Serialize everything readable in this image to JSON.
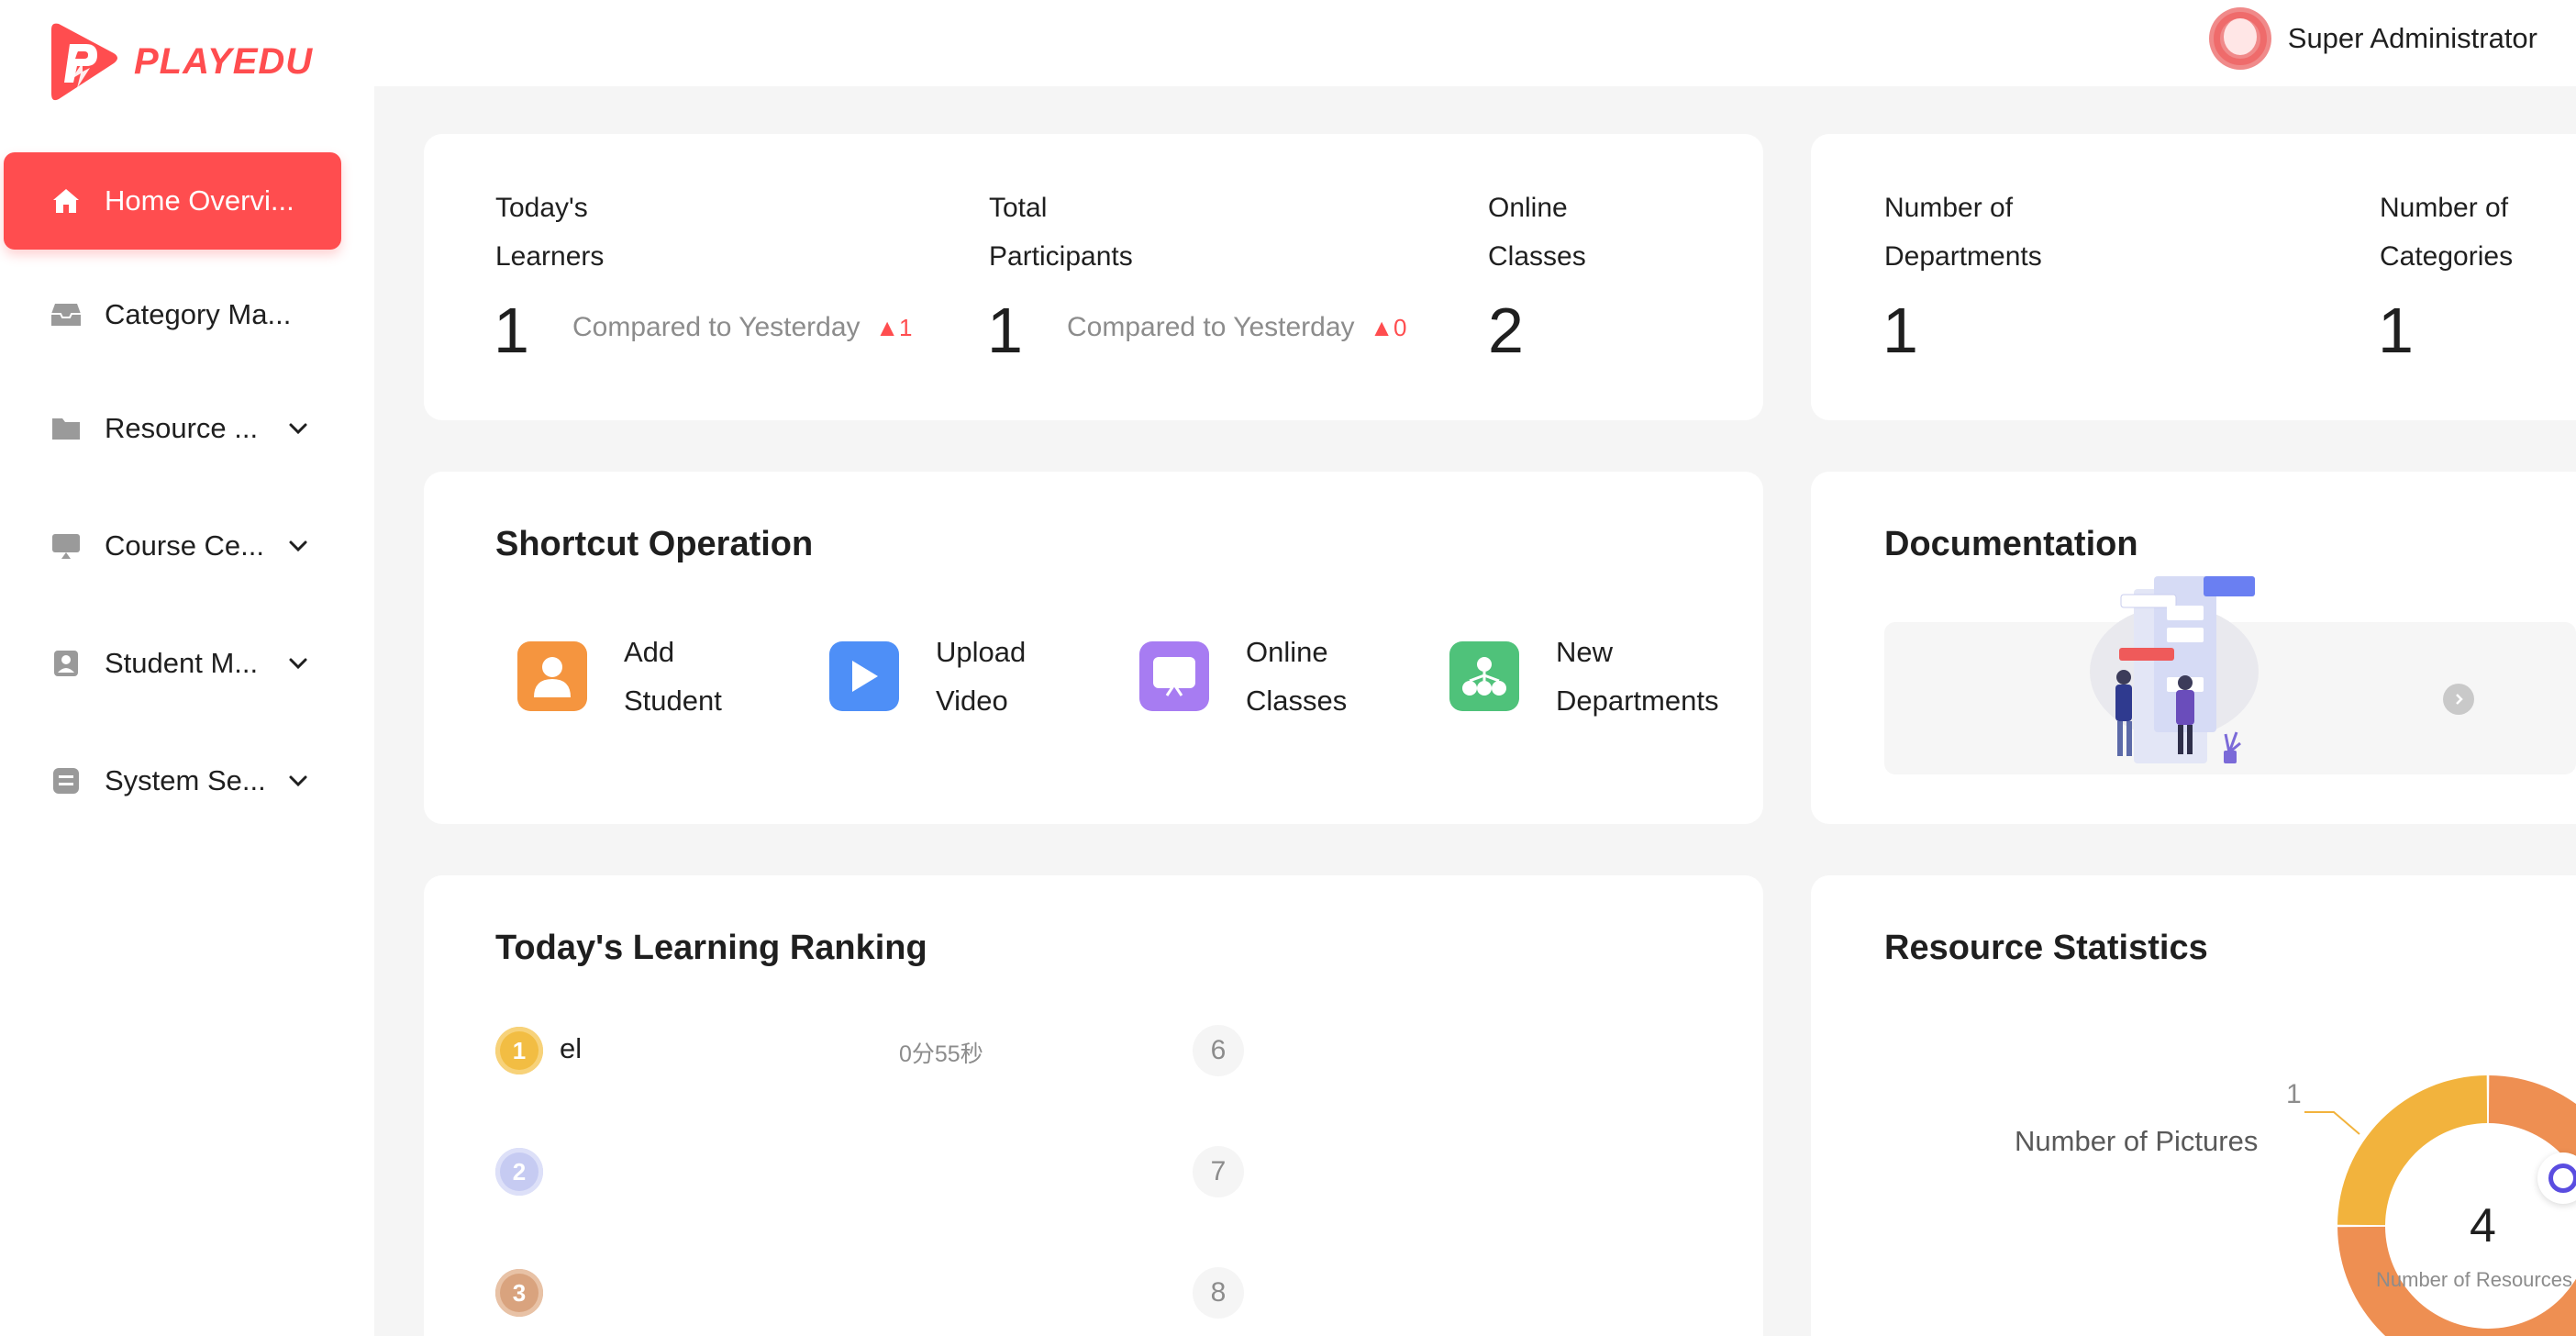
{
  "brand": {
    "name": "PLAYEDU",
    "color": "#ff4d4f"
  },
  "sidebar": {
    "items": [
      {
        "label": "Home Overvi...",
        "icon": "home-icon",
        "active": true
      },
      {
        "label": "Category Ma...",
        "icon": "inbox-icon"
      },
      {
        "label": "Resource ...",
        "icon": "folder-icon",
        "expandable": true
      },
      {
        "label": "Course Ce...",
        "icon": "screen-icon",
        "expandable": true
      },
      {
        "label": "Student M...",
        "icon": "student-icon",
        "expandable": true
      },
      {
        "label": "System Se...",
        "icon": "settings-icon",
        "expandable": true
      }
    ]
  },
  "header": {
    "user_name": "Super Administrator"
  },
  "stats": {
    "todays_learners": {
      "label_line1": "Today's",
      "label_line2": "Learners",
      "value": "1",
      "compare_text": "Compared to Yesterday",
      "delta": "1"
    },
    "total_participants": {
      "label_line1": "Total",
      "label_line2": "Participants",
      "value": "1",
      "compare_text": "Compared to Yesterday",
      "delta": "0"
    },
    "online_classes": {
      "label_line1": "Online",
      "label_line2": "Classes",
      "value": "2"
    },
    "departments": {
      "label_line1": "Number of",
      "label_line2": "Departments",
      "value": "1"
    },
    "categories": {
      "label_line1": "Number of",
      "label_line2": "Categories",
      "value": "1"
    }
  },
  "shortcuts": {
    "title": "Shortcut Operation",
    "items": [
      {
        "line1": "Add",
        "line2": "Student",
        "icon": "user-icon",
        "color": "#f5953f"
      },
      {
        "line1": "Upload",
        "line2": "Video",
        "icon": "play-icon",
        "color": "#4e8ff7"
      },
      {
        "line1": "Online",
        "line2": "Classes",
        "icon": "live-icon",
        "color": "#a77cf2"
      },
      {
        "line1": "New",
        "line2": "Departments",
        "icon": "department-icon",
        "color": "#4fc27a"
      }
    ]
  },
  "documentation": {
    "title": "Documentation"
  },
  "ranking": {
    "title": "Today's Learning Ranking",
    "rows": [
      {
        "rank": "1",
        "name": "el",
        "time": "0分55秒"
      },
      {
        "rank": "2",
        "name": "",
        "time": "",
        "num": "7"
      },
      {
        "rank": "3",
        "name": "",
        "time": "",
        "num": "8"
      }
    ],
    "first_num": "6"
  },
  "resources": {
    "title": "Resource Statistics",
    "center_value": "4",
    "center_label": "Number of Resources",
    "pictures_label": "Number of Pictures",
    "pictures_count": "1"
  },
  "chart_data": {
    "type": "pie",
    "title": "Resource Statistics",
    "total": 4,
    "total_label": "Number of Resources",
    "slices": [
      {
        "label": "Number of Pictures",
        "value": 1,
        "color": "#f2b33d"
      },
      {
        "label": "",
        "value": 3,
        "color": "#ee8f52"
      }
    ]
  }
}
